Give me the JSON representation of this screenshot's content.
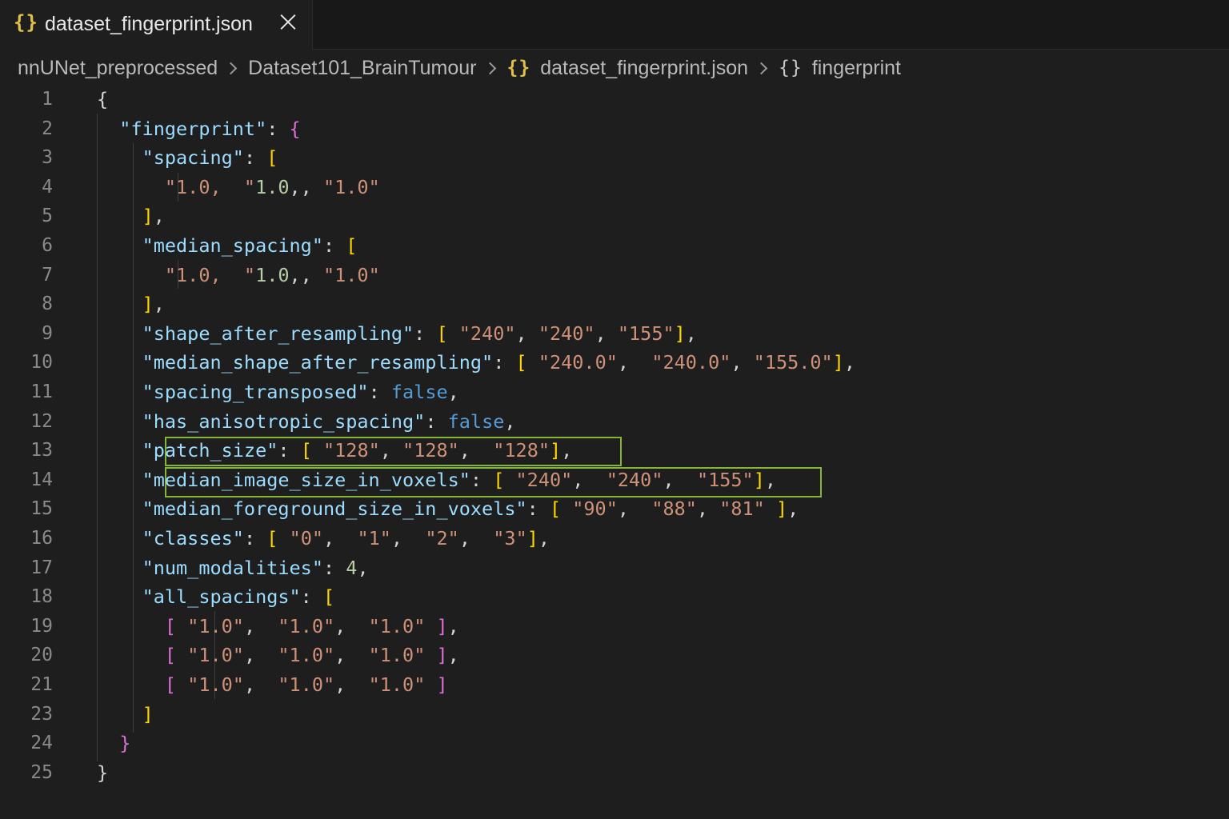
{
  "tab": {
    "icon": "json-braces-icon",
    "label": "dataset_fingerprint.json"
  },
  "breadcrumb": {
    "items": [
      "nnUNet_preprocessed",
      "Dataset101_BrainTumour",
      "dataset_fingerprint.json",
      "fingerprint"
    ],
    "icons": [
      "",
      "",
      "json-braces-icon",
      "object-braces-icon"
    ]
  },
  "line_numbers": [
    "1",
    "2",
    "3",
    "4",
    "5",
    "6",
    "7",
    "8",
    "9",
    "10",
    "11",
    "12",
    "13",
    "14",
    "15",
    "16",
    "17",
    "18",
    "19",
    "20",
    "21",
    "23",
    "24",
    "25"
  ],
  "code_lines": [
    "{",
    "  \"fingerprint\": {",
    "    \"spacing\": [",
    "      \"1.0,  \"1.0,, \"1.0\"",
    "    ],",
    "    \"median_spacing\": [",
    "      \"1.0,  \"1.0,, \"1.0\"",
    "    ],",
    "    \"shape_after_resampling\": [ \"240\", \"240\", \"155\"],",
    "    \"median_shape_after_resampling\": [ \"240.0\",  \"240.0\", \"155.0\"],",
    "    \"spacing_transposed\": false,",
    "    \"has_anisotropic_spacing\": false,",
    "    \"patch_size\": [ \"128\", \"128\",  \"128\"],",
    "    \"median_image_size_in_voxels\": [ \"240\",  \"240\",  \"155\"],",
    "    \"median_foreground_size_in_voxels\": [ \"90\",  \"88\", \"81\" ],",
    "    \"classes\": [ \"0\",  \"1\",  \"2\",  \"3\"],",
    "    \"num_modalities\": 4,",
    "    \"all_spacings\": [",
    "      [ \"1.0\",  \"1.0\",  \"1.0\" ],",
    "      [ \"1.0\",  \"1.0\",  \"1.0\" ],",
    "      [ \"1.0\",  \"1.0\",  \"1.0\" ]",
    "    ]",
    "  }",
    "}"
  ],
  "highlighted_keys": [
    "patch_size",
    "median_image_size_in_voxels"
  ],
  "colors": {
    "highlight_border": "#86b638",
    "key": "#9cdcfe",
    "string": "#ce9178",
    "keyword": "#569cd6",
    "number": "#b5cea8"
  }
}
